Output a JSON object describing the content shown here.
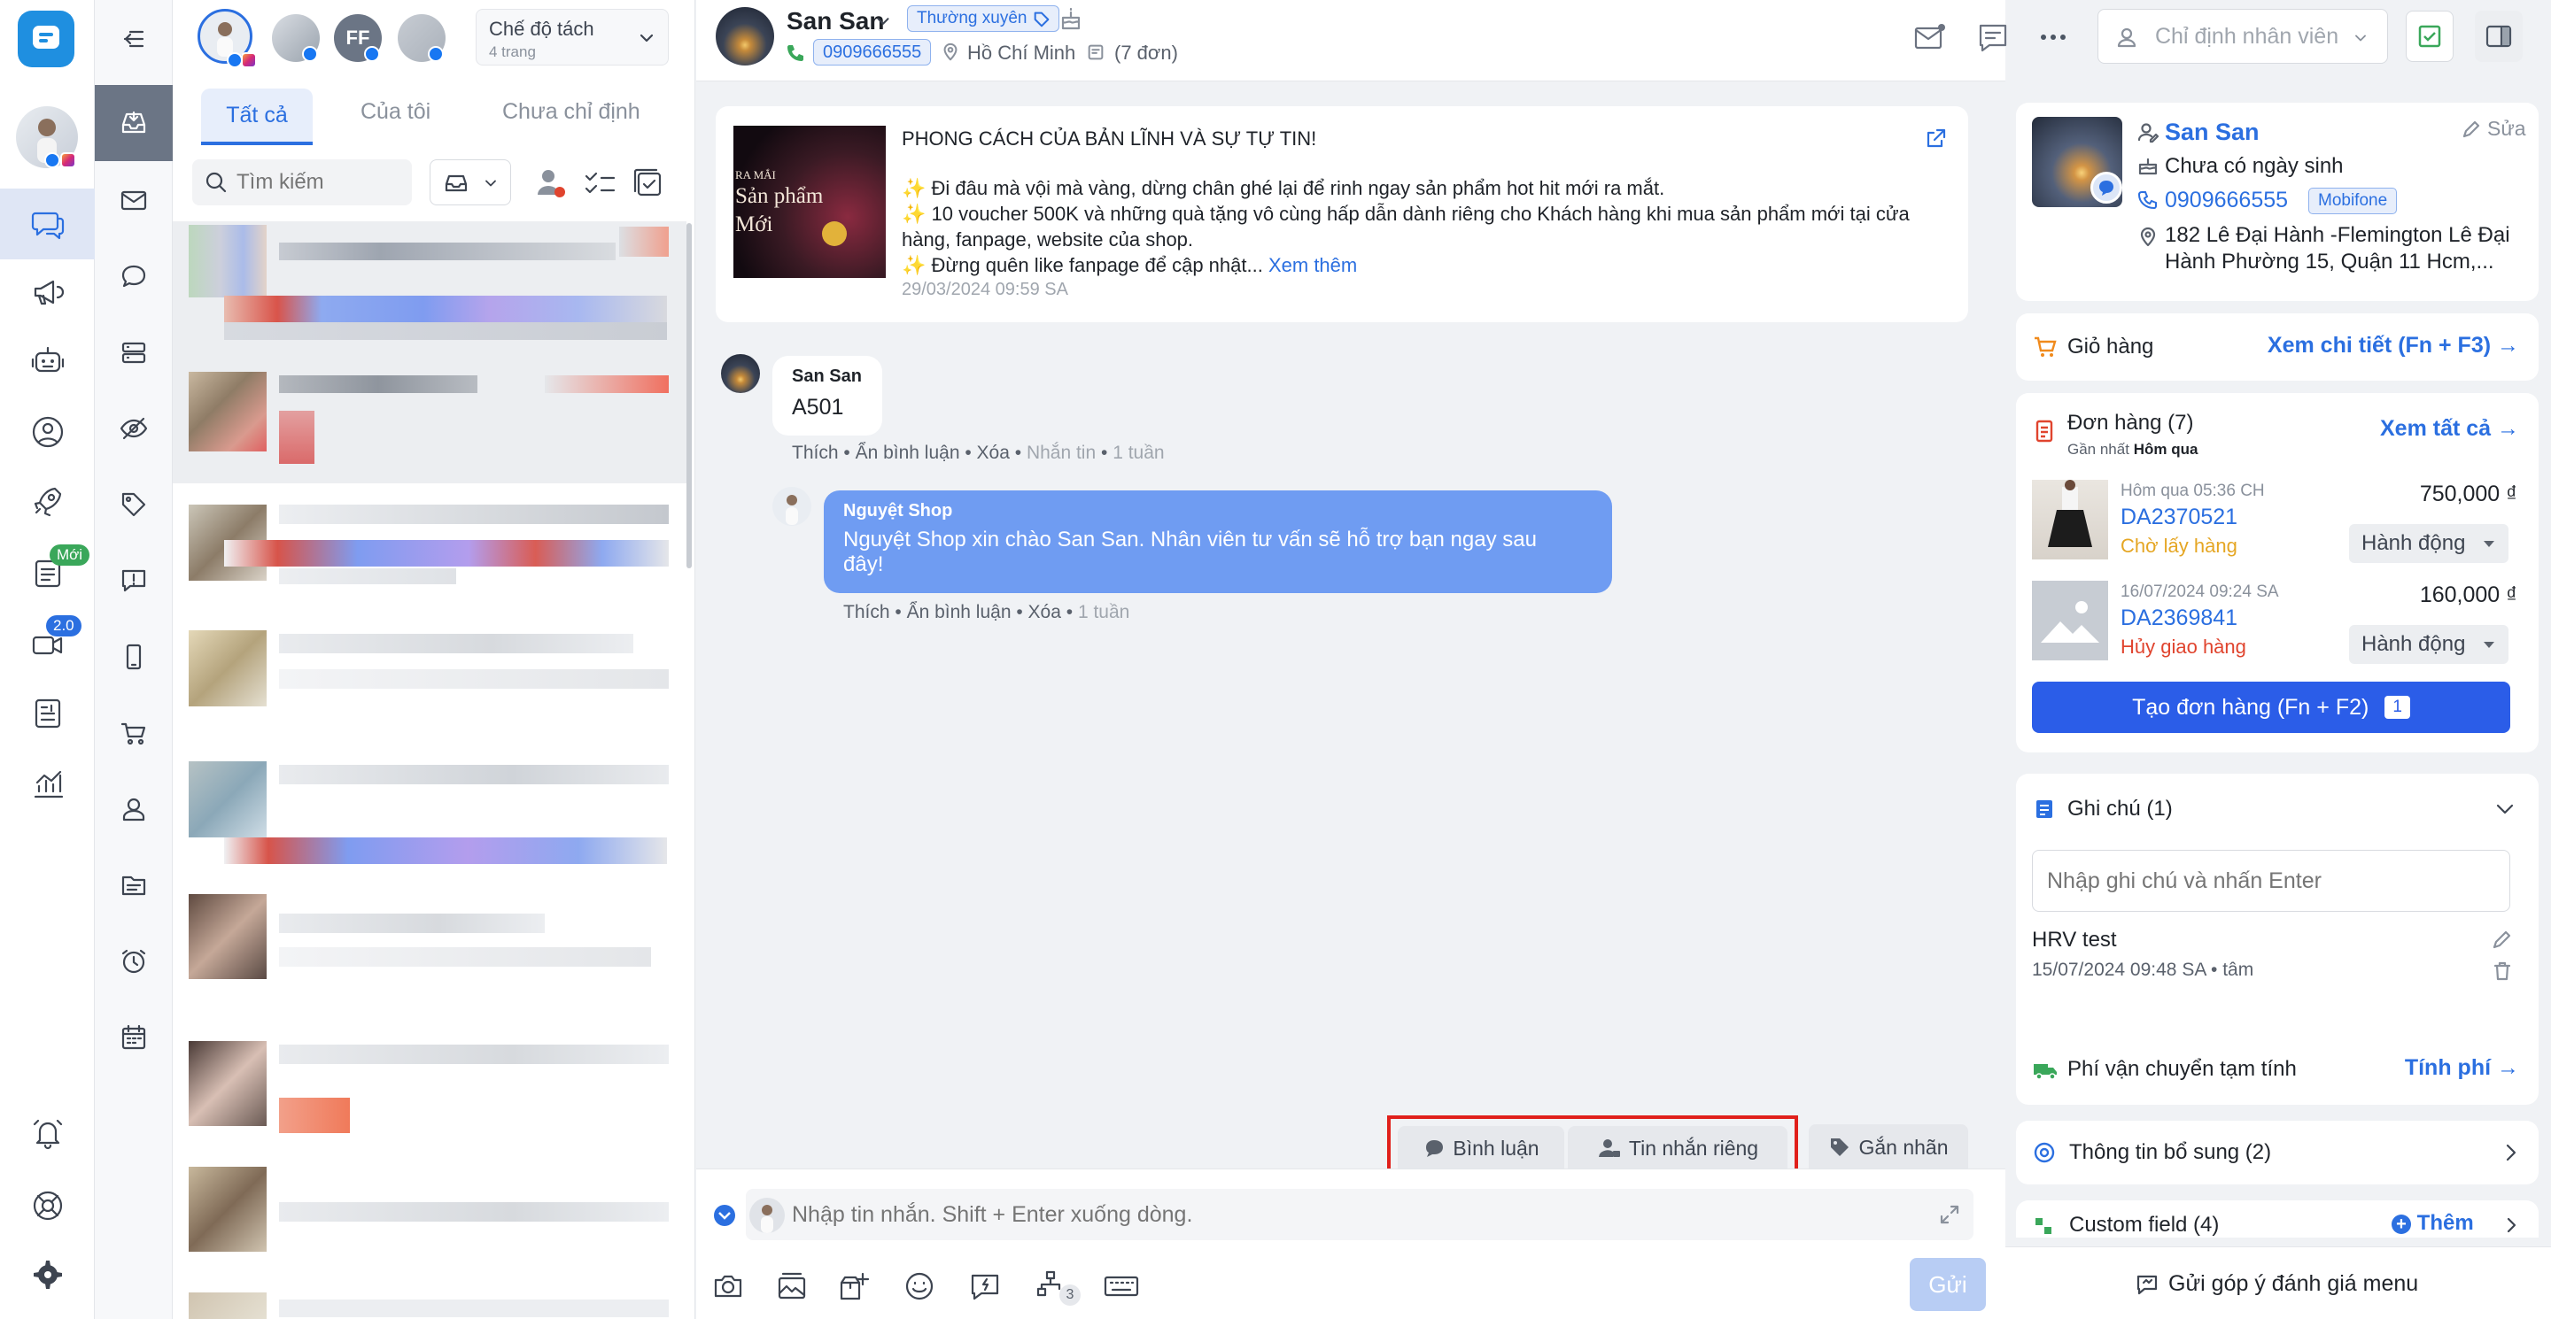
{
  "colors": {
    "accent": "#2b6fe0",
    "success": "#3aa75a",
    "warning": "#e5a623",
    "danger": "#e0442e",
    "bubble": "#6f9cf2",
    "highlight": "#e0201b"
  },
  "conversation_list": {
    "tabs": [
      {
        "label": "Tất cả"
      },
      {
        "label": "Của tôi"
      },
      {
        "label": "Chưa chỉ định"
      }
    ],
    "mode": {
      "label": "Chế độ tách",
      "sub": "4 trang"
    },
    "search_placeholder": "Tìm kiếm",
    "page_avatars": [
      {
        "label": ""
      },
      {
        "label": ""
      },
      {
        "label": "FF"
      },
      {
        "label": ""
      }
    ]
  },
  "rail": {
    "badge_new": "Mới",
    "badge_version": "2.0"
  },
  "chat": {
    "customer_name": "San San",
    "tag": "Thường xuyên",
    "phone": "0909666555",
    "location": "Hồ Chí Minh",
    "orders": "(7 đơn)",
    "assign_placeholder": "Chỉ định nhân viên",
    "post": {
      "title": "PHONG CÁCH CỦA BẢN LĨNH VÀ SỰ TỰ TIN!",
      "line1": "✨ Đi đâu mà vội mà vàng, dừng chân ghé lại để rinh ngay sản phẩm hot hit mới ra mắt.",
      "line2": "✨ 10 voucher 500K và những quà tặng vô cùng hấp dẫn dành riêng cho Khách hàng khi mua sản phẩm mới tại cửa",
      "line3": "hàng, fanpage, website của shop.",
      "line4": "✨ Đừng quên like fanpage để cập nhật...",
      "see_more": "Xem thêm",
      "time": "29/03/2024 09:59 SA",
      "thumb_line1": "RA MẮI",
      "thumb_line2": "Sản phẩm",
      "thumb_line3": "Mới"
    },
    "messages": [
      {
        "sender": "San San",
        "text": "A501",
        "actions": [
          "Thích",
          "Ẩn bình luận",
          "Xóa",
          "Nhắn tin"
        ],
        "time": "1 tuần"
      },
      {
        "sender": "Nguyệt Shop",
        "text_line1": "Nguyệt Shop xin chào San San. Nhân viên tư vấn sẽ hỗ trợ bạn ngay sau",
        "text_line2": "đây!",
        "actions": [
          "Thích",
          "Ẩn bình luận",
          "Xóa"
        ],
        "time": "1 tuần"
      }
    ],
    "composer": {
      "tab_comment": "Bình luận",
      "tab_private": "Tin nhắn riêng",
      "tab_label": "Gắn nhãn",
      "placeholder": "Nhập tin nhắn. Shift + Enter xuống dòng.",
      "send": "Gửi",
      "flow_count": "3"
    }
  },
  "customer": {
    "name": "San San",
    "edit": "Sửa",
    "birthday": "Chưa có ngày sinh",
    "phone": "0909666555",
    "carrier": "Mobifone",
    "address_line1": "182 Lê Đại Hành -Flemington Lê Đại",
    "address_line2": "Hành Phường 15, Quận 11 Hcm,..."
  },
  "cart": {
    "label": "Giỏ hàng",
    "link": "Xem chi tiết (Fn + F3)"
  },
  "orders": {
    "title": "Đơn hàng (7)",
    "latest_prefix": "Gần nhất",
    "latest_value": "Hôm qua",
    "view_all": "Xem tất cả",
    "items": [
      {
        "time": "Hôm qua 05:36 CH",
        "code": "DA2370521",
        "status": "Chờ lấy hàng",
        "amount": "750,000 ₫",
        "action": "Hành động"
      },
      {
        "time": "16/07/2024 09:24 SA",
        "code": "DA2369841",
        "status": "Hủy giao hàng",
        "amount": "160,000 ₫",
        "action": "Hành động"
      }
    ],
    "create": "Tạo đơn hàng (Fn + F2)",
    "create_count": "1"
  },
  "notes": {
    "title": "Ghi chú (1)",
    "placeholder": "Nhập ghi chú và nhấn Enter",
    "item_text": "HRV test",
    "item_meta": "15/07/2024 09:48 SA • tâm"
  },
  "shipping": {
    "label": "Phí vận chuyển tạm tính",
    "link": "Tính phí"
  },
  "extra": {
    "label": "Thông tin bổ sung (2)"
  },
  "custom_field": {
    "label": "Custom field (4)",
    "add": "Thêm"
  },
  "feedback": {
    "label": "Gửi góp ý đánh giá menu"
  }
}
